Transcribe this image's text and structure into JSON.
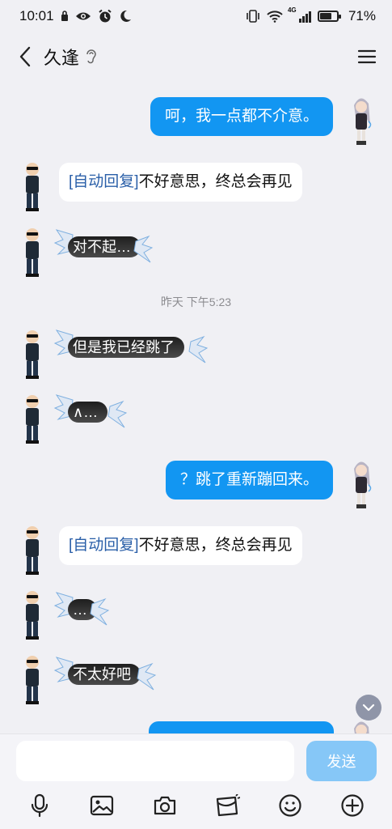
{
  "status_bar": {
    "time": "10:01",
    "network": "4G",
    "battery_percent": "71%",
    "battery_level": 0.71
  },
  "header": {
    "title": "久逢",
    "icons": [
      "back-arrow-icon",
      "ear-icon",
      "menu-icon"
    ]
  },
  "messages": [
    {
      "side": "out",
      "type": "text",
      "text": "呵，我一点都不介意。"
    },
    {
      "side": "in",
      "type": "auto",
      "tag": "[自动回复]",
      "text": "不好意思，终总会再见"
    },
    {
      "side": "in",
      "type": "sticker",
      "text": "对不起…"
    },
    {
      "type": "time",
      "text": "昨天 下午5:23"
    },
    {
      "side": "in",
      "type": "sticker",
      "text": "但是我已经跳了"
    },
    {
      "side": "in",
      "type": "sticker",
      "text": "∧…"
    },
    {
      "side": "out",
      "type": "text",
      "text": "？跳了重新蹦回来。"
    },
    {
      "side": "in",
      "type": "auto",
      "tag": "[自动回复]",
      "text": "不好意思，终总会再见"
    },
    {
      "side": "in",
      "type": "sticker",
      "text": "…"
    },
    {
      "side": "in",
      "type": "sticker",
      "text": "不太好吧"
    }
  ],
  "input": {
    "placeholder": "",
    "send_label": "发送"
  },
  "toolbar": [
    "mic-icon",
    "image-icon",
    "camera-icon",
    "red-packet-icon",
    "emoji-icon",
    "plus-icon"
  ],
  "colors": {
    "accent": "#1296f2",
    "background": "#f0f0f4",
    "send_disabled": "#86c7f7",
    "auto_tag": "#2a5fa8"
  }
}
